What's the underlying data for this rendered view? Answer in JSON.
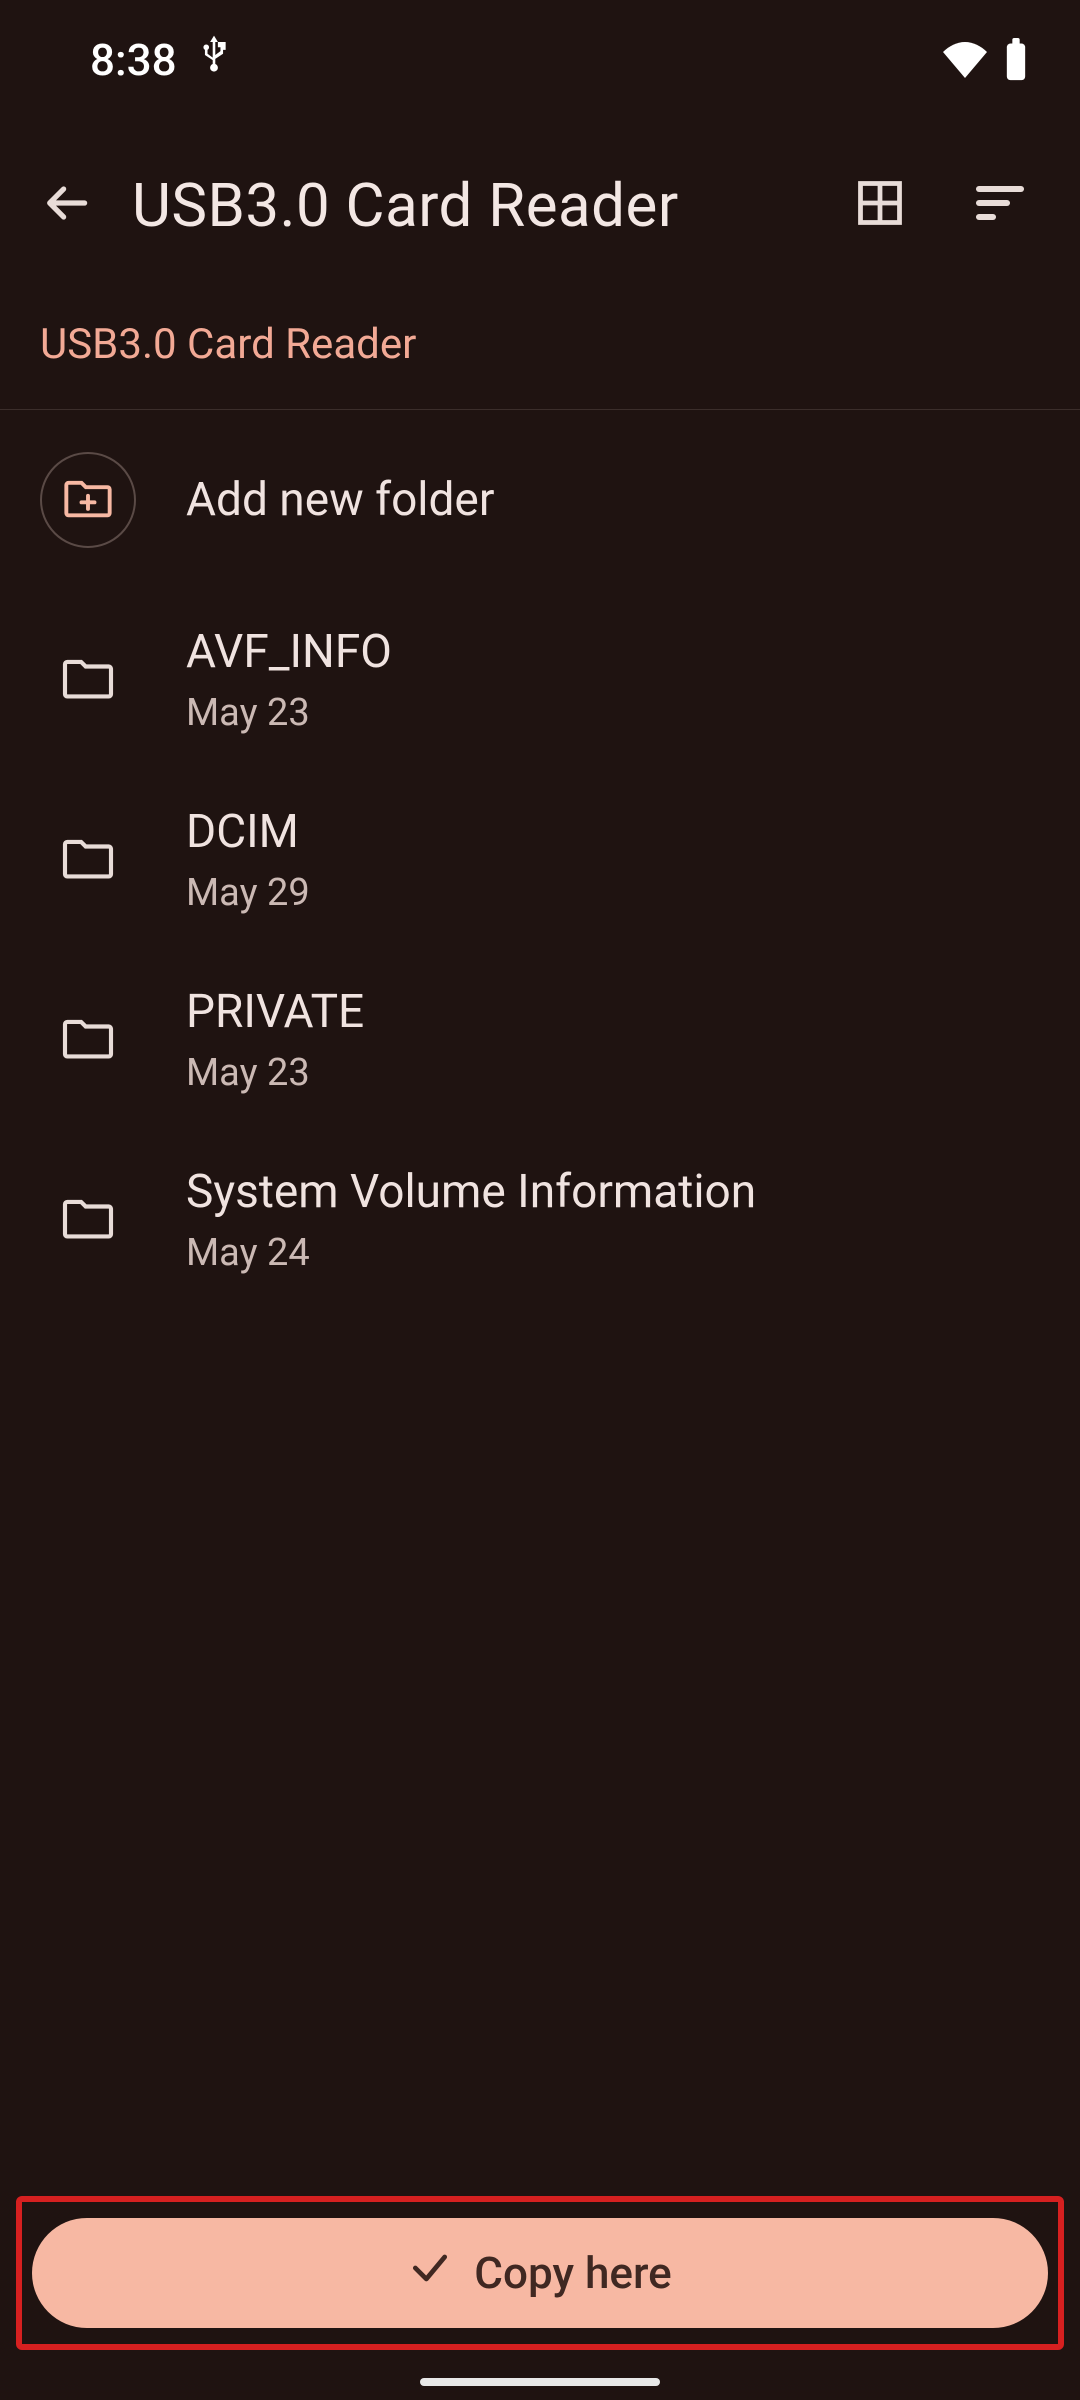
{
  "status": {
    "time": "8:38"
  },
  "appbar": {
    "title": "USB3.0 Card Reader"
  },
  "breadcrumb": "USB3.0 Card Reader",
  "addFolder": {
    "label": "Add new folder"
  },
  "folders": [
    {
      "name": "AVF_INFO",
      "date": "May 23"
    },
    {
      "name": "DCIM",
      "date": "May 29"
    },
    {
      "name": "PRIVATE",
      "date": "May 23"
    },
    {
      "name": "System Volume Information",
      "date": "May 24"
    }
  ],
  "action": {
    "label": "Copy here"
  }
}
